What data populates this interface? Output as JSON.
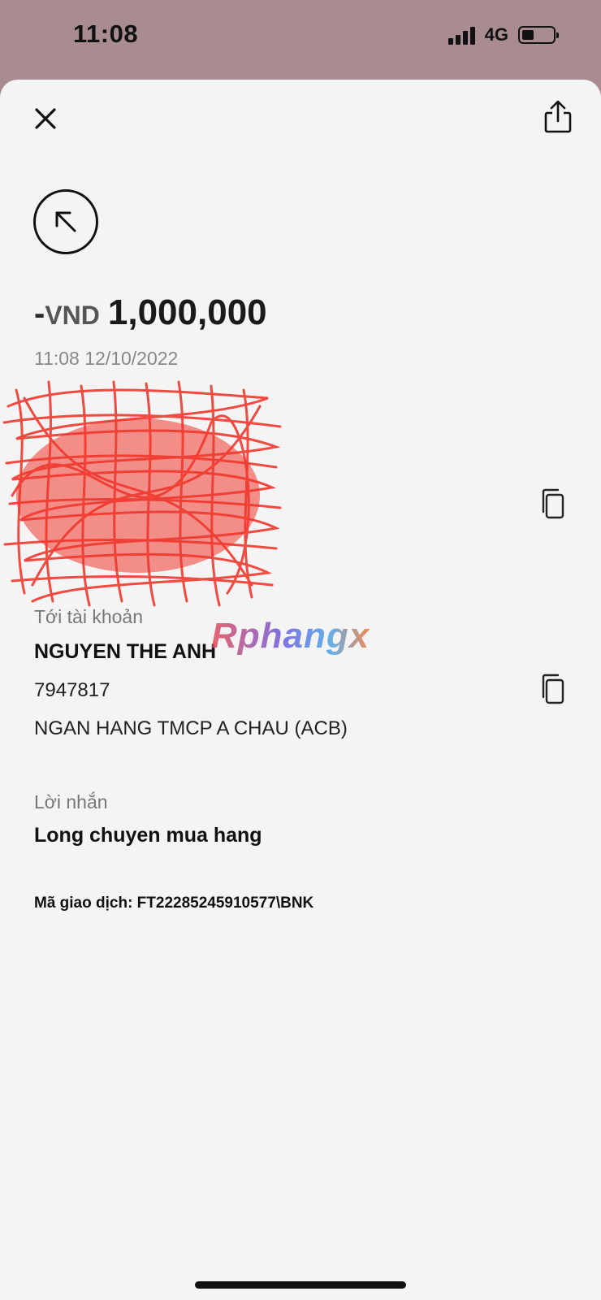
{
  "status_bar": {
    "time": "11:08",
    "network": "4G",
    "signal_icon": "signal-bars-icon",
    "battery_icon": "battery-icon",
    "battery_level": 0.3
  },
  "header": {
    "close_icon": "close-icon",
    "share_icon": "share-icon"
  },
  "transaction": {
    "direction_icon": "arrow-up-left-icon",
    "sign": "-",
    "currency": "VND",
    "amount": "1,000,000",
    "datetime": "11:08 12/10/2022",
    "copy_icon": "copy-icon"
  },
  "recipient": {
    "label": "Tới tài khoản",
    "name": "NGUYEN THE ANH",
    "account": "7947817",
    "bank": "NGAN HANG TMCP A CHAU (ACB)"
  },
  "message": {
    "label": "Lời nhắn",
    "value": "Long chuyen mua hang"
  },
  "reference": {
    "text": "Mã giao dịch: FT22285245910577\\BNK"
  },
  "watermark": {
    "text": "Rphangx"
  },
  "colors": {
    "status_bg": "#a88c8f",
    "sheet_bg": "#f5f4f4",
    "redaction": "#f0382e"
  }
}
